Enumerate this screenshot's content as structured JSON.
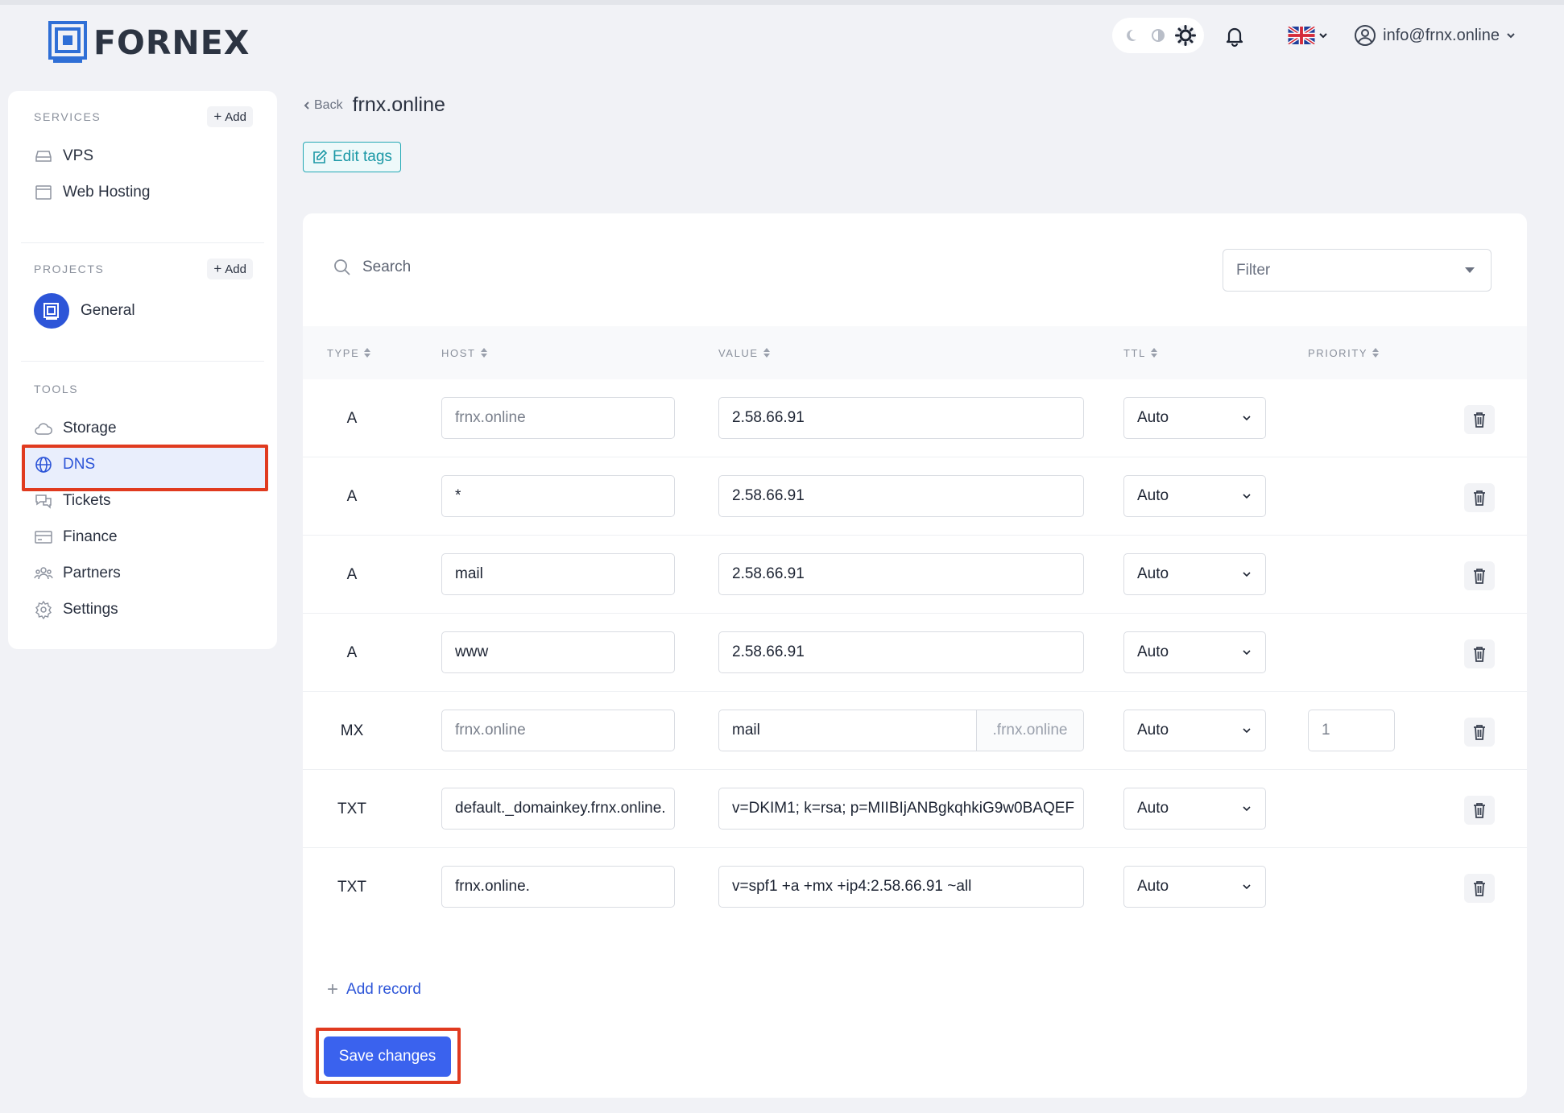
{
  "brand": {
    "name": "FORNEX"
  },
  "header": {
    "theme_options": [
      "moon-icon",
      "half-circle-icon",
      "sun-icon"
    ],
    "user_email": "info@frnx.online",
    "language": "uk-flag-icon"
  },
  "sidebar": {
    "services_title": "SERVICES",
    "services_add": "Add",
    "services": [
      {
        "label": "VPS",
        "icon": "server-icon"
      },
      {
        "label": "Web Hosting",
        "icon": "browser-window-icon"
      }
    ],
    "projects_title": "PROJECTS",
    "projects_add": "Add",
    "projects": [
      {
        "label": "General"
      }
    ],
    "tools_title": "TOOLS",
    "tools": [
      {
        "label": "Storage",
        "icon": "cloud-icon"
      },
      {
        "label": "DNS",
        "icon": "globe-icon",
        "active": true
      },
      {
        "label": "Tickets",
        "icon": "chat-icon"
      },
      {
        "label": "Finance",
        "icon": "card-icon"
      },
      {
        "label": "Partners",
        "icon": "people-icon"
      },
      {
        "label": "Settings",
        "icon": "gear-icon"
      }
    ]
  },
  "page": {
    "back_label": "Back",
    "domain": "frnx.online",
    "edit_tags_label": "Edit tags"
  },
  "dns": {
    "search_placeholder": "Search",
    "filter_placeholder": "Filter",
    "columns": [
      "TYPE",
      "HOST",
      "VALUE",
      "TTL",
      "PRIORITY"
    ],
    "records": [
      {
        "type": "A",
        "host": "frnx.online",
        "host_placeholder": true,
        "value": "2.58.66.91",
        "ttl": "Auto"
      },
      {
        "type": "A",
        "host": "*",
        "value": "2.58.66.91",
        "ttl": "Auto"
      },
      {
        "type": "A",
        "host": "mail",
        "value": "2.58.66.91",
        "ttl": "Auto"
      },
      {
        "type": "A",
        "host": "www",
        "value": "2.58.66.91",
        "ttl": "Auto"
      },
      {
        "type": "MX",
        "host": "frnx.online",
        "host_placeholder": true,
        "value": "mail",
        "value_suffix": ".frnx.online",
        "ttl": "Auto",
        "priority": "1"
      },
      {
        "type": "TXT",
        "host": "default._domainkey.frnx.online.",
        "value": "v=DKIM1; k=rsa; p=MIIBIjANBgkqhkiG9w0BAQEF",
        "ttl": "Auto"
      },
      {
        "type": "TXT",
        "host": "frnx.online.",
        "value": "v=spf1 +a +mx +ip4:2.58.66.91 ~all",
        "ttl": "Auto"
      }
    ],
    "add_record_label": "Add record",
    "save_label": "Save changes"
  },
  "colors": {
    "accent": "#3a62ee",
    "highlight_border": "#e03a1f",
    "tag_teal": "#1b98a6"
  }
}
